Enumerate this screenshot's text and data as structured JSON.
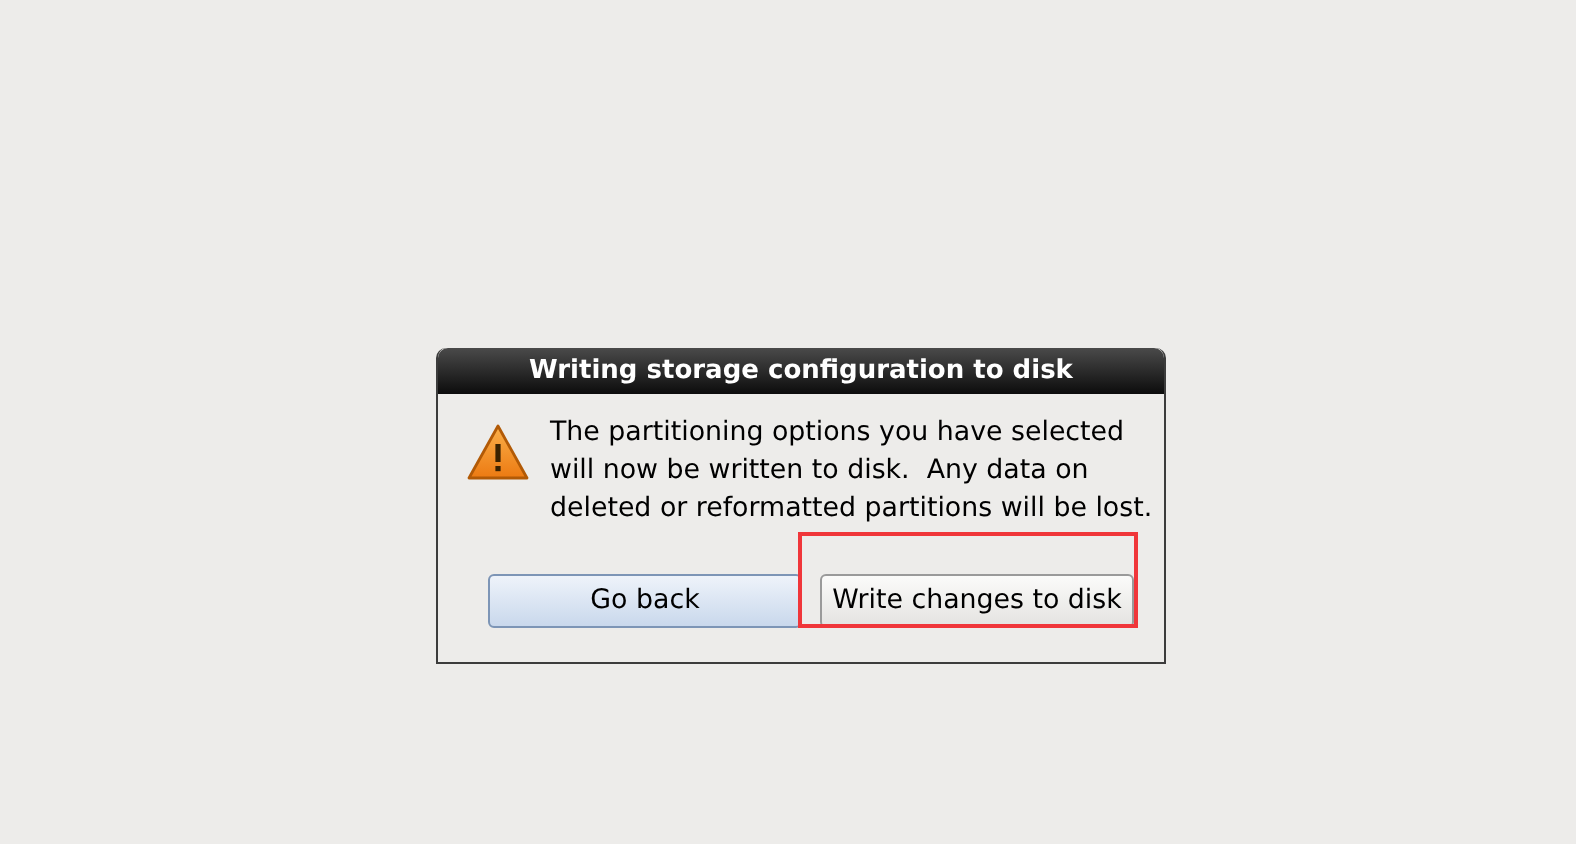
{
  "dialog": {
    "title": "Writing storage configuration to disk",
    "message": "The partitioning options you have selected\nwill now be written to disk.  Any data on\ndeleted or reformatted partitions will be lost.",
    "buttons": [
      {
        "label": "Go back",
        "default": true,
        "highlighted": false
      },
      {
        "label": "Write changes to disk",
        "default": false,
        "highlighted": true
      }
    ]
  }
}
